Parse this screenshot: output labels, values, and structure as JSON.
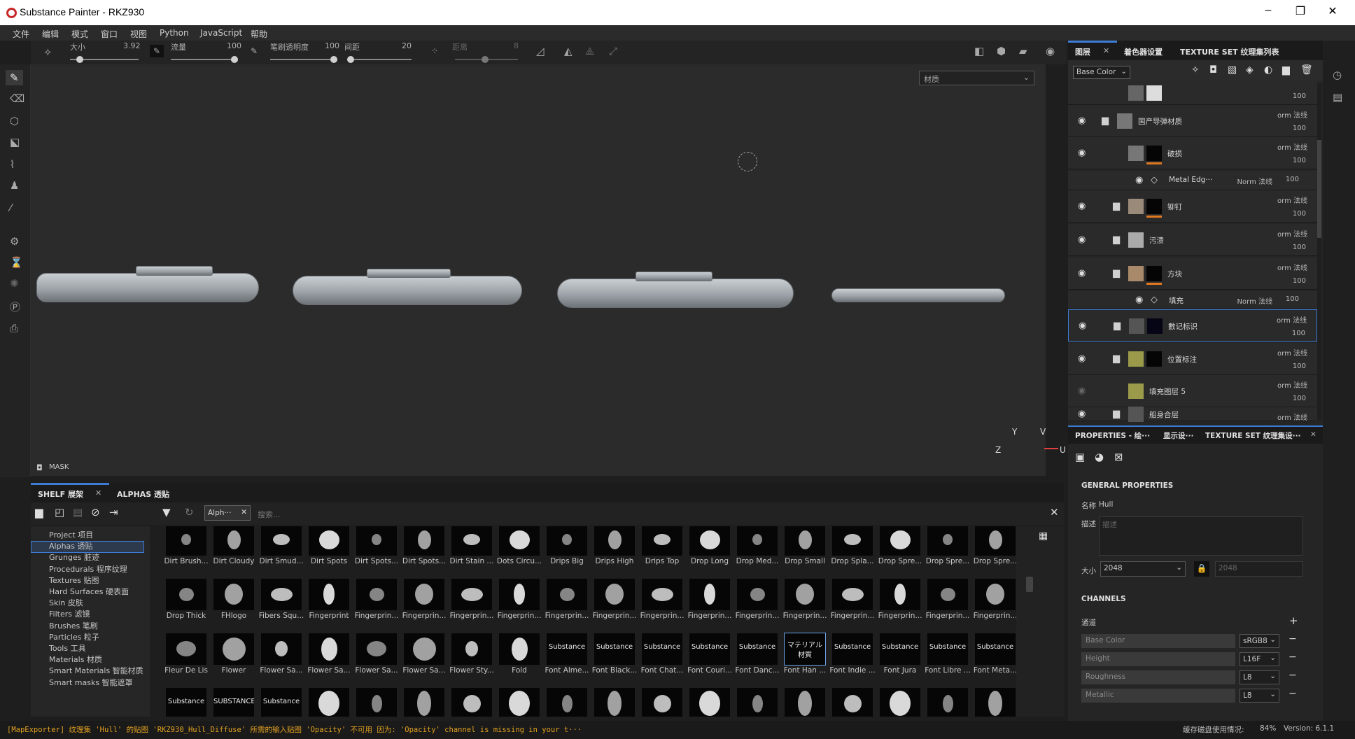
{
  "window": {
    "title": "Substance Painter - RKZ930"
  },
  "menu": [
    "文件",
    "编辑",
    "模式",
    "窗口",
    "视图",
    "Python",
    "JavaScript",
    "帮助"
  ],
  "toolbar": {
    "size_label": "大小",
    "size_value": "3.92",
    "flow_label": "流量",
    "flow_value": "100",
    "stroke_opacity_label": "笔刷透明度",
    "stroke_opacity_value": "100",
    "spacing_label": "间距",
    "spacing_value": "20",
    "distance_label": "距离",
    "distance_value": "8"
  },
  "viewport": {
    "material_select": "材质",
    "mask_label": "MASK",
    "axis_y": "Y",
    "axis_z": "Z",
    "axis_v": "V",
    "axis_u": "U"
  },
  "shelf": {
    "tab_shelf": "SHELF 展架",
    "tab_alphas": "ALPHAS 透贴",
    "filter_chip": "Alph···",
    "search_placeholder": "搜索...",
    "categories": [
      "Project 项目",
      "Alphas 透贴",
      "Grunges 脏迹",
      "Procedurals 程序纹理",
      "Textures 贴图",
      "Hard Surfaces 硬表面",
      "Skin 皮肤",
      "Filters 滤镜",
      "Brushes 笔刷",
      "Particles 粒子",
      "Tools 工具",
      "Materials 材质",
      "Smart Materials 智能材质",
      "Smart masks 智能遮罩"
    ],
    "selected_category": 1,
    "rows": [
      [
        "Dirt Brush...",
        "Dirt Cloudy",
        "Dirt Smud...",
        "Dirt Spots",
        "Dirt Spots...",
        "Dirt Spots...",
        "Dirt Stain ...",
        "Dots Circu...",
        "Drips Big",
        "Drips High",
        "Drips Top",
        "Drop Long",
        "Drop Med...",
        "Drop Small",
        "Drop Spla...",
        "Drop Spre...",
        "Drop Spre...",
        "Drop Spre..."
      ],
      [
        "Drop Thick",
        "FHlogo",
        "Fibers Squ...",
        "Fingerprint",
        "Fingerprin...",
        "Fingerprin...",
        "Fingerprin...",
        "Fingerprin...",
        "Fingerprin...",
        "Fingerprin...",
        "Fingerprin...",
        "Fingerprin...",
        "Fingerprin...",
        "Fingerprin...",
        "Fingerprin...",
        "Fingerprin...",
        "Fingerprin...",
        "Fingerprin..."
      ],
      [
        "Fleur De Lis",
        "Flower",
        "Flower Sa...",
        "Flower Sa...",
        "Flower Sa...",
        "Flower Sa...",
        "Flower Sty...",
        "Fold",
        "Font Alme...",
        "Font Black...",
        "Font Chat...",
        "Font Couri...",
        "Font Danc...",
        "Font Han ...",
        "Font Indie ...",
        "Font Jura",
        "Font Libre ...",
        "Font Meta..."
      ],
      [
        "",
        "",
        "",
        "",
        "",
        "",
        "",
        "",
        "",
        "",
        "",
        "",
        "",
        "",
        "",
        "",
        "",
        ""
      ]
    ],
    "font_thumbs": {
      "r2c8": "Substance",
      "r2c9": "Substance",
      "r2c10": "Substance",
      "r2c11": "Substance",
      "r2c12": "Substance",
      "r2c13a": "マテリアル",
      "r2c13b": "材質",
      "r2c14": "Substance",
      "r2c15": "Substance",
      "r2c16": "Substance",
      "r2c17": "Substance",
      "r3c0": "Substance",
      "r3c1": "SUBSTANCE",
      "r3c2": "Substance"
    }
  },
  "layers": {
    "tabs": [
      "图层",
      "着色器设置",
      "TEXTURE SET 纹理集列表"
    ],
    "channel_select": "Base Color",
    "rows": [
      {
        "name": "",
        "blend": "",
        "opacity": "100"
      },
      {
        "name": "国产导弹材质",
        "blend": "orm 法线",
        "opacity": "100"
      },
      {
        "name": "破损",
        "blend": "orm 法线",
        "opacity": "100"
      },
      {
        "name": "Metal Edg···",
        "blend": "Norm 法线",
        "opacity": "100"
      },
      {
        "name": "铆钉",
        "blend": "orm 法线",
        "opacity": "100"
      },
      {
        "name": "污渍",
        "blend": "orm 法线",
        "opacity": "100"
      },
      {
        "name": "方块",
        "blend": "orm 法线",
        "opacity": "100"
      },
      {
        "name": "填充",
        "blend": "Norm 法线",
        "opacity": "100"
      },
      {
        "name": "數记标识",
        "blend": "orm 法线",
        "opacity": "100"
      },
      {
        "name": "位置标注",
        "blend": "orm 法线",
        "opacity": "100"
      },
      {
        "name": "填充图层 5",
        "blend": "orm 法线",
        "opacity": "100"
      },
      {
        "name": "船身合层",
        "blend": "orm 法线",
        "opacity": ""
      }
    ]
  },
  "properties": {
    "tabs": [
      "PROPERTIES - 绘···",
      "显示设···",
      "TEXTURE SET 纹理集设···"
    ],
    "general_header": "GENERAL PROPERTIES",
    "name_label": "名称",
    "name_value": "Hull",
    "desc_label": "描述",
    "desc_placeholder": "描述",
    "size_label": "大小",
    "size_value": "2048",
    "size_linked": "2048",
    "channels_header": "CHANNELS",
    "channel_label": "通道",
    "channels": [
      {
        "name": "Base Color",
        "format": "sRGB8"
      },
      {
        "name": "Height",
        "format": "L16F"
      },
      {
        "name": "Roughness",
        "format": "L8"
      },
      {
        "name": "Metallic",
        "format": "L8"
      }
    ]
  },
  "status": {
    "message": "[MapExporter] 纹理集 'Hull' 的贴图 'RKZ930_Hull_Diffuse' 所需的输入贴图 'Opacity' 不可用 因为: 'Opacity' channel is missing in your t···",
    "cache_label": "缓存磁盘使用情况:",
    "cache_value": "84%",
    "version": "Version: 6.1.1"
  }
}
